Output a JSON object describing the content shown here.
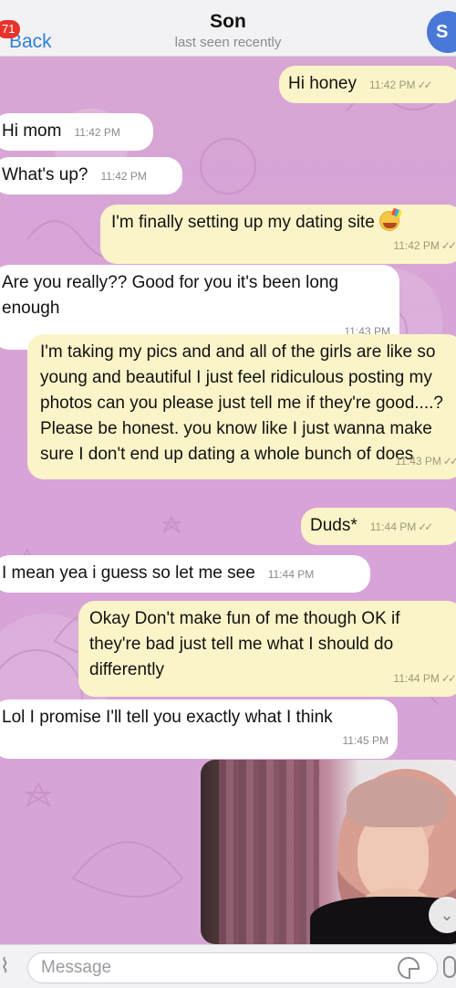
{
  "header": {
    "back_label": "Back",
    "unread_count": "71",
    "title": "Son",
    "subtitle": "last seen recently",
    "avatar_initial": "S"
  },
  "messages": [
    {
      "dir": "out",
      "text": "Hi honey",
      "time": "11:42 PM",
      "read": true
    },
    {
      "dir": "in",
      "text": "Hi mom",
      "time": "11:42 PM"
    },
    {
      "dir": "in",
      "text": "What's up?",
      "time": "11:42 PM"
    },
    {
      "dir": "out",
      "text": "I'm finally setting up my dating site",
      "emoji": "partying-face",
      "time": "11:42 PM",
      "read": true
    },
    {
      "dir": "in",
      "text": "Are you really?? Good for you it's been long enough",
      "time": "11:43 PM"
    },
    {
      "dir": "out",
      "text": "I'm taking my pics and and all of the girls are like so young and beautiful I just feel ridiculous posting my photos can you please just tell me if they're good....? Please be honest. you know like I just wanna make sure I don't end up dating a whole bunch of does",
      "time": "11:43 PM",
      "read": true
    },
    {
      "dir": "out",
      "text": "Duds*",
      "time": "11:44 PM",
      "read": true
    },
    {
      "dir": "in",
      "text": "I mean yea i guess so let me see",
      "time": "11:44 PM"
    },
    {
      "dir": "out",
      "text": "Okay Don't make fun of me though OK if they're bad just tell me what I should do differently",
      "time": "11:44 PM",
      "read": true
    },
    {
      "dir": "in",
      "text": "Lol I promise I'll tell you exactly what I think",
      "time": "11:45 PM"
    }
  ],
  "input": {
    "placeholder": "Message"
  },
  "colors": {
    "incoming_bubble": "#ffffff",
    "outgoing_bubble": "#fbf4c8",
    "accent": "#2f7fd8",
    "badge": "#e8322c",
    "wallpaper": "#d9a9d6"
  },
  "icons": {
    "attach": "paperclip-icon",
    "sticker": "sticker-icon",
    "mic": "microphone-icon",
    "scroll": "chevron-down-icon",
    "read": "double-check-icon"
  }
}
